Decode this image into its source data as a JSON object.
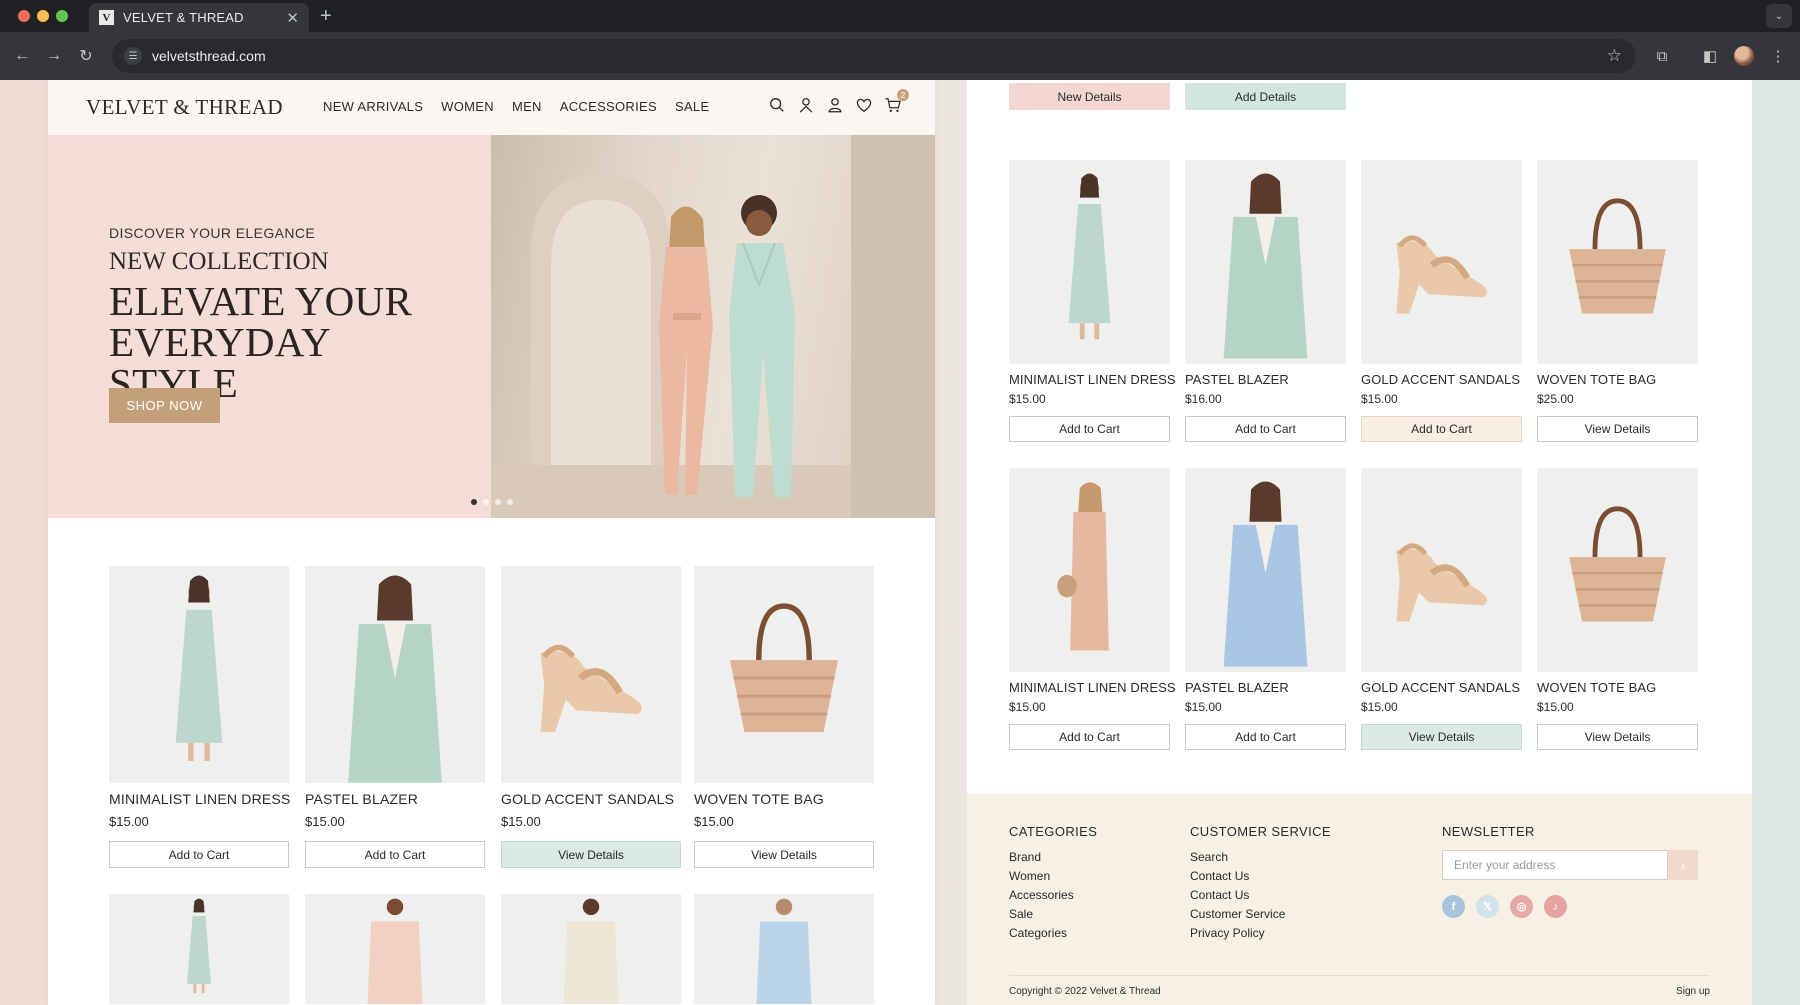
{
  "browser": {
    "tab_title": "VELVET & THREAD",
    "tab_favicon": "V",
    "url": "velvetsthread.com"
  },
  "site": {
    "logo": "VELVET & THREAD",
    "nav": [
      "NEW ARRIVALS",
      "WOMEN",
      "MEN",
      "ACCESSORIES",
      "SALE"
    ],
    "cart_count": "2",
    "icons": [
      "search-icon",
      "user-icon",
      "account-icon",
      "heart-icon",
      "cart-icon"
    ]
  },
  "hero": {
    "eyebrow": "DISCOVER YOUR ELEGANCE",
    "subtitle": "NEW COLLECTION",
    "headline": "ELEVATE YOUR EVERYDAY STYLE",
    "cta": "SHOP NOW",
    "slide_count": 4,
    "active_slide": 1
  },
  "left_products": [
    {
      "name": "MINIMALIST LINEN DRESS",
      "price": "$15.00",
      "button": "Add to Cart",
      "style": "plain",
      "img": "dress-mint"
    },
    {
      "name": "PASTEL BLAZER",
      "price": "$15.00",
      "button": "Add to Cart",
      "style": "plain",
      "img": "blazer-mint"
    },
    {
      "name": "GOLD ACCENT SANDALS",
      "price": "$15.00",
      "button": "View Details",
      "style": "mint",
      "img": "sandals"
    },
    {
      "name": "WOVEN TOTE BAG",
      "price": "$15.00",
      "button": "View Details",
      "style": "plain",
      "img": "tote"
    }
  ],
  "left_products_row2": [
    {
      "img": "dress-mint"
    },
    {
      "img": "shirt-peach"
    },
    {
      "img": "shirt-cream"
    },
    {
      "img": "shirt-blue"
    }
  ],
  "right_top_buttons": [
    {
      "label": "New Details",
      "style": "pink"
    },
    {
      "label": "Add Details",
      "style": "mintsolid"
    }
  ],
  "right_products": [
    {
      "name": "MINIMALIST LINEN DRESS",
      "price": "$15.00",
      "button": "Add to Cart",
      "style": "plain",
      "img": "dress-mint"
    },
    {
      "name": "PASTEL BLAZER",
      "price": "$16.00",
      "button": "Add to Cart",
      "style": "plain",
      "img": "blazer-mint"
    },
    {
      "name": "GOLD ACCENT SANDALS",
      "price": "$15.00",
      "button": "Add to Cart",
      "style": "peach",
      "img": "sandals"
    },
    {
      "name": "WOVEN TOTE BAG",
      "price": "$25.00",
      "button": "View Details",
      "style": "plain",
      "img": "tote"
    },
    {
      "name": "MINIMALIST LINEN DRESS",
      "price": "$15.00",
      "button": "Add to Cart",
      "style": "plain",
      "img": "dress-peach"
    },
    {
      "name": "PASTEL BLAZER",
      "price": "$15.00",
      "button": "Add to Cart",
      "style": "plain",
      "img": "blazer-blue"
    },
    {
      "name": "GOLD ACCENT SANDALS",
      "price": "$15.00",
      "button": "View Details",
      "style": "mint",
      "img": "sandals"
    },
    {
      "name": "WOVEN TOTE BAG",
      "price": "$15.00",
      "button": "View Details",
      "style": "plain",
      "img": "tote"
    }
  ],
  "footer": {
    "categories_title": "CATEGORIES",
    "categories": [
      "Brand",
      "Women",
      "Accessories",
      "Sale",
      "Categories"
    ],
    "service_title": "CUSTOMER SERVICE",
    "service": [
      "Search",
      "Contact Us",
      "Contact Us",
      "Customer Service",
      "Privacy Policy"
    ],
    "newsletter_title": "NEWSLETTER",
    "newsletter_placeholder": "Enter your address",
    "newsletter_button": "›",
    "socials": [
      {
        "icon": "facebook-icon",
        "glyph": "f",
        "color": "#a9c3dd"
      },
      {
        "icon": "x-icon",
        "glyph": "𝕏",
        "color": "#cfe3e8"
      },
      {
        "icon": "instagram-icon",
        "glyph": "◎",
        "color": "#e7a9a3"
      },
      {
        "icon": "tiktok-icon",
        "glyph": "♪",
        "color": "#e6a2a0"
      }
    ],
    "copyright": "Copyright © 2022 Velvet  & Thread",
    "signup": "Sign up"
  },
  "colors": {
    "accent": "#c4a07a",
    "mint": "#dae9e3",
    "pink": "#f4d6d2",
    "hero_bg": "#f3ddd6"
  }
}
